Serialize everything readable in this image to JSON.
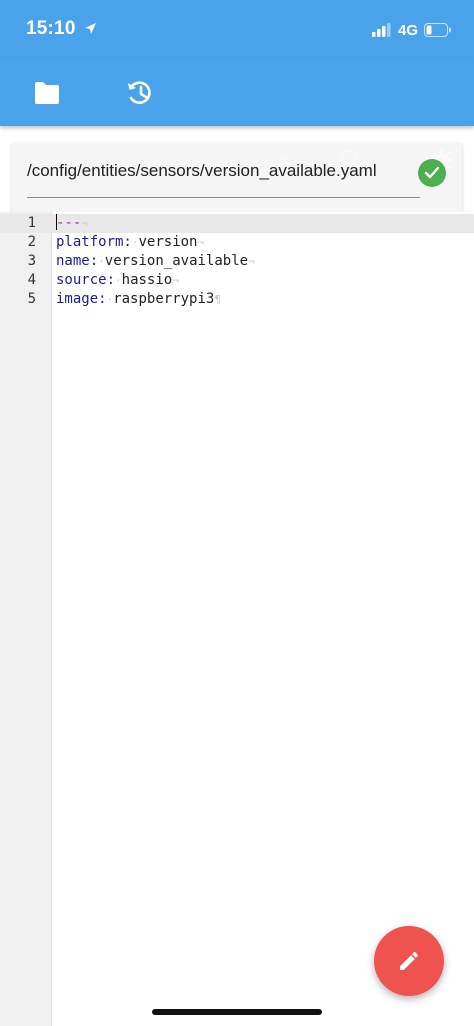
{
  "status_bar": {
    "time": "15:10",
    "network": "4G"
  },
  "toolbar": {
    "icons": [
      "folder-icon",
      "history-icon"
    ]
  },
  "file": {
    "path": "/config/entities/sensors/version_available.yaml",
    "valid": true
  },
  "editor": {
    "line_numbers": [
      "1",
      "2",
      "3",
      "4",
      "5"
    ],
    "lines": [
      {
        "key": "---",
        "value": ""
      },
      {
        "key": "platform:",
        "value": "version"
      },
      {
        "key": "name:",
        "value": "version_available"
      },
      {
        "key": "source:",
        "value": "hassio"
      },
      {
        "key": "image:",
        "value": "raspberrypi3"
      }
    ]
  },
  "fab": {
    "icon": "pencil-icon"
  },
  "colors": {
    "primary": "#4aa3ea",
    "accent": "#ef5350",
    "valid": "#4caf50",
    "yaml_key": "#1c1c8c",
    "yaml_doc": "#aa22aa"
  }
}
